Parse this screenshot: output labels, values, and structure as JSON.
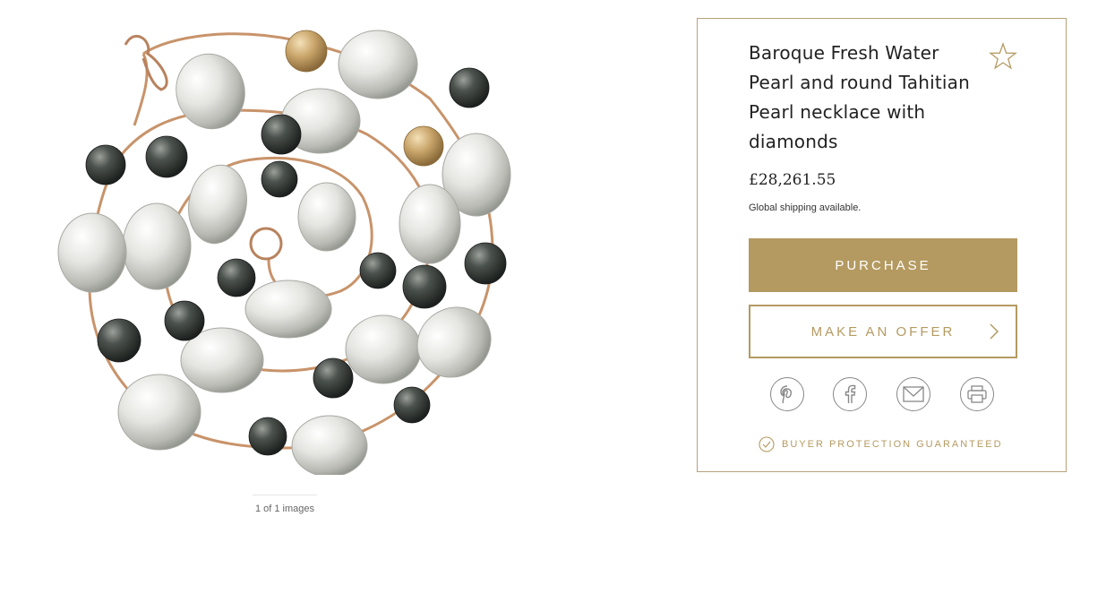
{
  "gallery": {
    "image_alt": "Baroque Fresh Water Pearl and round Tahitian Pearl necklace with diamonds",
    "image_count": "1 of 1 images"
  },
  "product": {
    "title": "Baroque Fresh Water Pearl and round Tahitian Pearl necklace with diamonds",
    "price": "£28,261.55",
    "shipping": "Global shipping available.",
    "purchase_label": "PURCHASE",
    "offer_label": "MAKE AN OFFER",
    "protection_label": "BUYER PROTECTION GUARANTEED"
  },
  "share": {
    "icons": [
      "pinterest-icon",
      "facebook-icon",
      "email-icon",
      "print-icon"
    ]
  },
  "colors": {
    "accent": "#b49a61",
    "border": "#b8a07a",
    "text": "#222222"
  }
}
